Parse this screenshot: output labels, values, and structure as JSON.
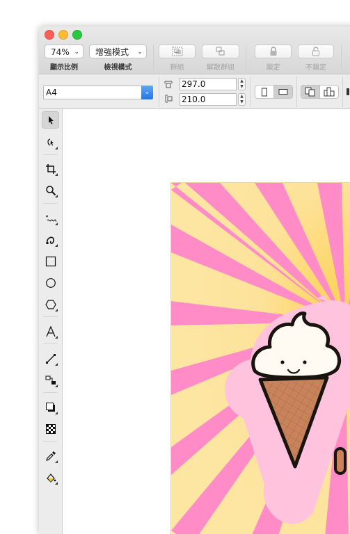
{
  "toolbar": {
    "zoom": {
      "value": "74%",
      "label": "顯示比例"
    },
    "view_mode": {
      "value": "增強模式",
      "label": "檢視模式"
    },
    "group_label": "群組",
    "ungroup_label": "解散群組",
    "lock_label": "鎖定",
    "unlock_label": "不鎖定"
  },
  "properties": {
    "page_size": "A4",
    "width": "297.0",
    "height": "210.0",
    "orientation": "landscape"
  },
  "tools": [
    "pointer",
    "node-edit",
    "crop",
    "zoom",
    "freehand",
    "bezier",
    "rectangle",
    "ellipse",
    "polygon",
    "text",
    "line",
    "connector",
    "shadow",
    "transparency",
    "eyedropper",
    "fill"
  ],
  "artwork": {
    "colors": {
      "background": "#fde6a2",
      "rays": "#ff8cc6",
      "sticker_outline": "#ffc3dd",
      "cone": "#c8835a",
      "cream": "#fffaf2",
      "ink": "#1a1410"
    }
  }
}
